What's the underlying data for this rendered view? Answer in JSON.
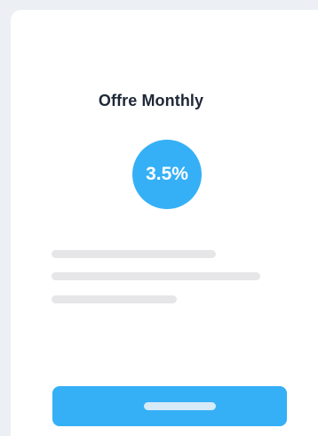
{
  "offer": {
    "title": "Offre Monthly",
    "rate": "3.5%"
  },
  "colors": {
    "accent": "#35b0f6",
    "background": "#eceff3",
    "card": "#ffffff",
    "title_text": "#1f2838",
    "placeholder": "#e6e6e8"
  }
}
